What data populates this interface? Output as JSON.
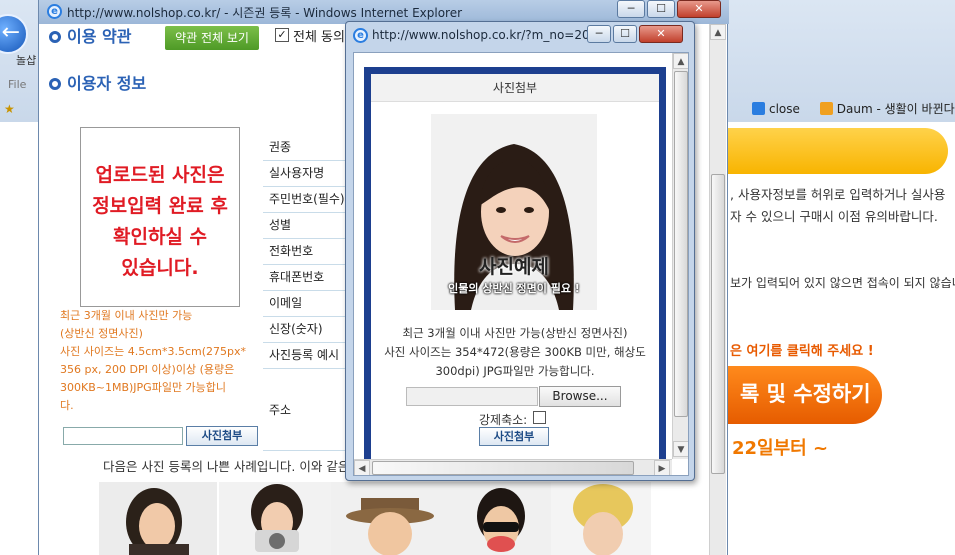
{
  "bg_window": {
    "tab_label": "놀샵",
    "menu_file": "File",
    "fav_star": "★",
    "links": [
      "close",
      "Daum - 생활이 바뀐다"
    ],
    "notice_text": ", 사용자정보를 허위로 입력하거나 실사용자 수 있으니 구매시 이점 유의바랍니다.",
    "notice_text2": "보가 입력되어 있지 않으면 접속이 되지 않습니다",
    "click_text": "은 여기를 클릭해 주세요 !",
    "edit_button": "록 및 수정하기",
    "date_text": "22일부터 ~"
  },
  "main_window": {
    "title": "http://www.nolshop.co.kr/ - 시즌권 등록 - Windows Internet Explorer",
    "section_terms": "이용 약관",
    "terms_button": "약관 전체 보기",
    "agree_label": "전체 동의",
    "section_user": "이용자 정보",
    "photo_message": [
      "업로드된 사진은",
      "정보입력 완료 후",
      "확인하실 수",
      "있습니다."
    ],
    "photo_note": [
      "최근 3개월 이내 사진만 가능",
      "(상반신 정면사진)",
      "사진 사이즈는 4.5cm*3.5cm(275px*",
      "356 px, 200 DPI 이상)이상 (용량은",
      "300KB~1MB)JPG파일만 가능합니",
      "다."
    ],
    "attach_button": "사진첨부",
    "form_rows": [
      "권종",
      "실사용자명",
      "주민번호(필수)",
      "성별",
      "전화번호",
      "휴대폰번호",
      "이메일",
      "신장(숫자)",
      "사진등록 예시",
      "주소"
    ],
    "bad_examples_note": "다음은 사진 등록의 나쁜 사례입니다. 이와 같은 경우"
  },
  "popup": {
    "title": "http://www.nolshop.co.kr/?m_no=20...",
    "header": "사진첨부",
    "sample_caption": "사진예제",
    "sample_sub": "인물의 상반신 정면이 필요 !",
    "desc_lines": [
      "최근 3개월 이내 사진만 가능(상반신 정면사진)",
      "사진 사이즈는 354*472(용량은 300KB 미만, 해상도",
      "300dpi) JPG파일만 가능합니다."
    ],
    "browse_button": "Browse...",
    "force_label": "강제축소:",
    "attach_button": "사진첨부"
  },
  "window_buttons": {
    "minimize": "─",
    "maximize": "☐",
    "close": "✕"
  },
  "icons": {
    "ie": "e",
    "back_arrow": "←",
    "scroll_up": "▲",
    "scroll_down": "▼",
    "scroll_left": "◀",
    "scroll_right": "▶",
    "check": "✓"
  },
  "colors": {
    "accent_blue": "#2b62b5",
    "notice_red": "#e01b24",
    "note_orange": "#e07820",
    "terms_green": "#5aa52f",
    "popup_frame": "#1d3f8f"
  }
}
